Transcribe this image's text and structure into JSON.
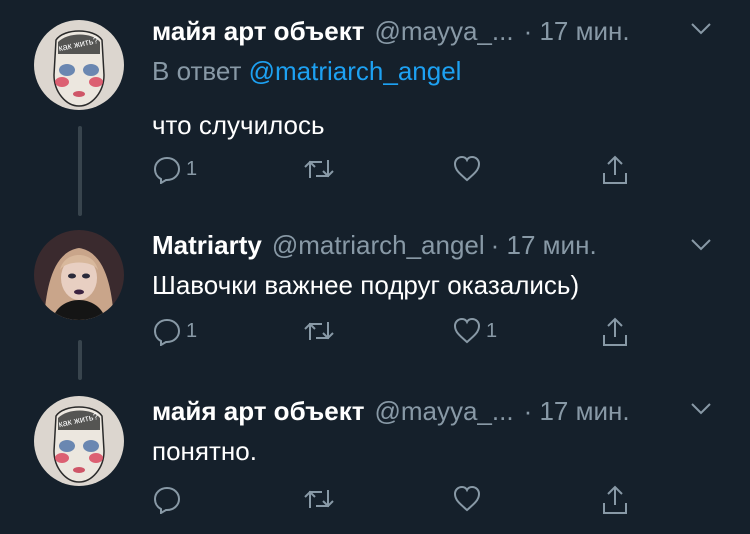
{
  "tweets": [
    {
      "name": "майя арт объект",
      "handle": "@mayya_...",
      "time": "· 17 мин.",
      "reply_prefix": "В ответ",
      "reply_mention": "@matriarch_angel",
      "text": "что случилось",
      "actions": {
        "reply_count": "1",
        "retweet_count": "",
        "like_count": ""
      },
      "avatar_caption": "как жить?"
    },
    {
      "name": "Matriarty",
      "handle": "@matriarch_angel",
      "time": "· 17 мин.",
      "text": "Шавочки важнее подруг оказались)",
      "actions": {
        "reply_count": "1",
        "retweet_count": "",
        "like_count": "1"
      }
    },
    {
      "name": "майя арт объект",
      "handle": "@mayya_...",
      "time": "· 17 мин.",
      "text": "понятно.",
      "actions": {
        "reply_count": "",
        "retweet_count": "",
        "like_count": ""
      },
      "avatar_caption": "как жить?"
    }
  ],
  "colors": {
    "background": "#15202b",
    "primary_text": "#ffffff",
    "secondary_text": "#8899a6",
    "link": "#1da1f2",
    "thread_line": "#38444d"
  },
  "icons": [
    "reply-icon",
    "retweet-icon",
    "like-icon",
    "share-icon",
    "chevron-down-icon"
  ]
}
